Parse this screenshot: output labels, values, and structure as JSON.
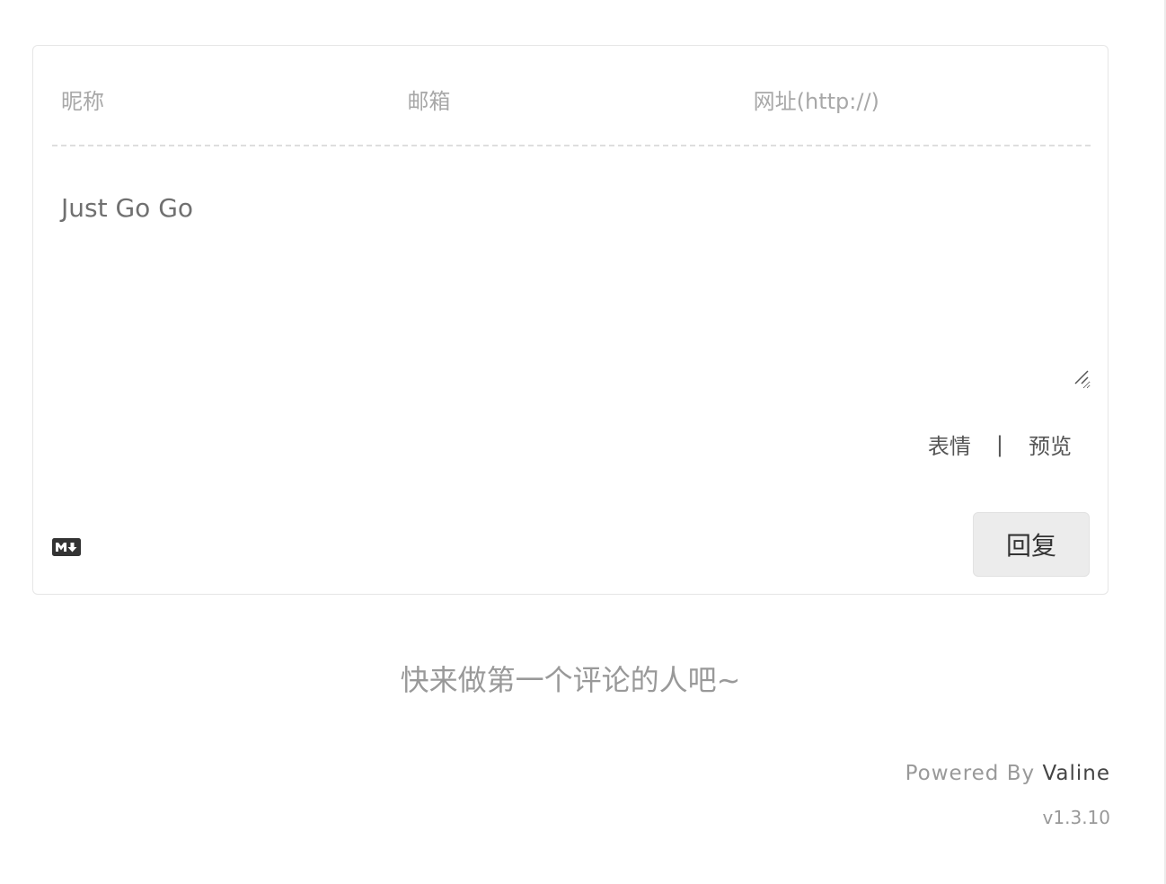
{
  "header": {
    "nick_placeholder": "昵称",
    "mail_placeholder": "邮箱",
    "link_placeholder": "网址(http://)"
  },
  "editor": {
    "placeholder": "Just Go Go"
  },
  "toolbar": {
    "emoji_label": "表情",
    "separator": "|",
    "preview_label": "预览"
  },
  "footer_bar": {
    "markdown_icon": "markdown-icon",
    "reply_label": "回复"
  },
  "empty_message": "快来做第一个评论的人吧~",
  "powered_by": {
    "prefix": "Powered By",
    "brand": "Valine",
    "version": "v1.3.10"
  },
  "colors": {
    "placeholder": "#a8a8a8",
    "text": "#555555",
    "button_bg": "#ececec",
    "muted": "#999999"
  }
}
